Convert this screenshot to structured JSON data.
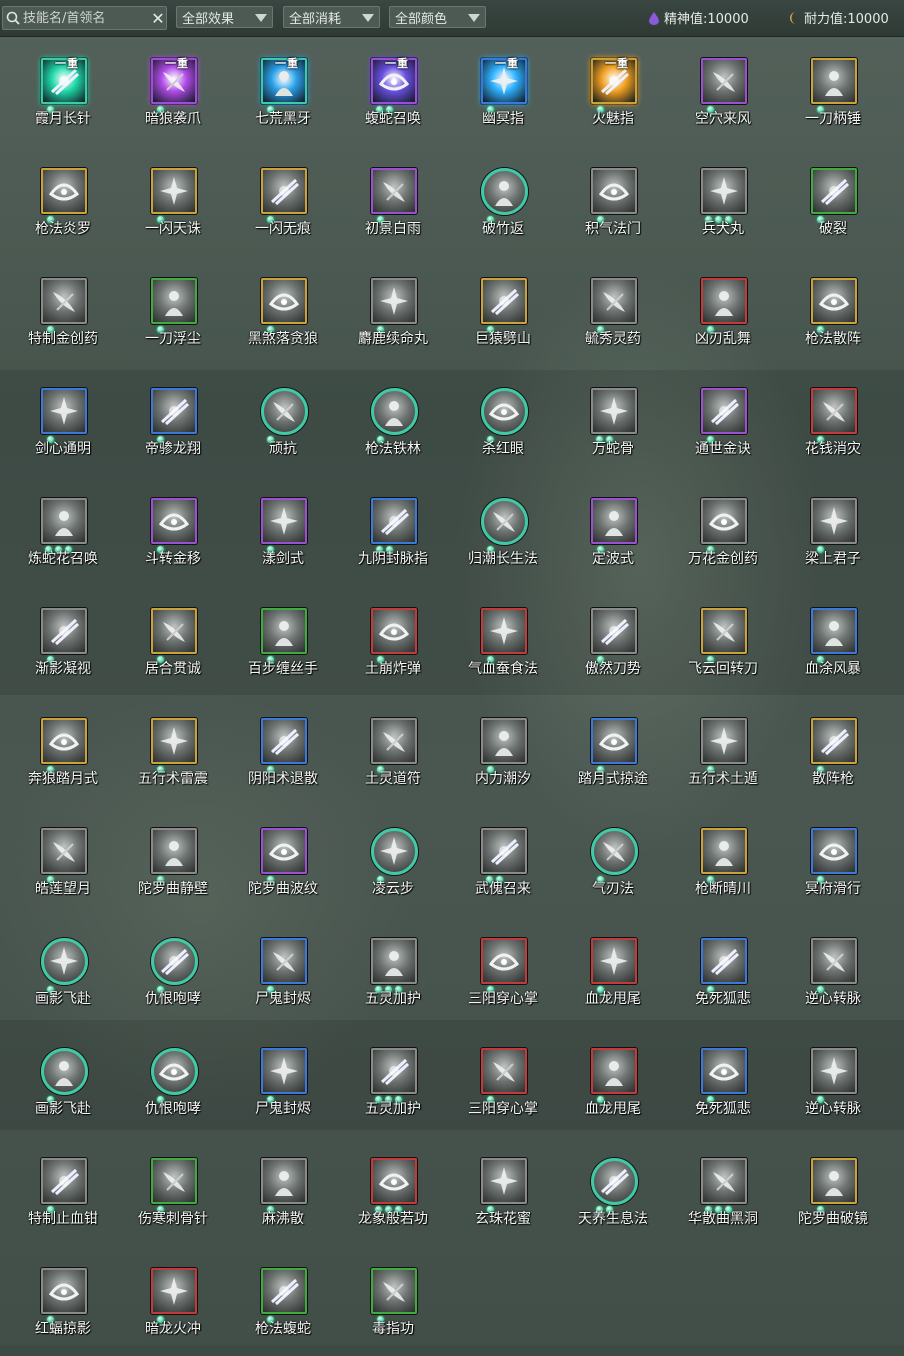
{
  "toolbar": {
    "search_placeholder": "技能名/首领名",
    "filter_effect": "全部效果",
    "filter_cost": "全部消耗",
    "filter_color": "全部颜色",
    "spirit_label": "精神值:10000",
    "stamina_label": "耐力值:10000"
  },
  "colors": {
    "gold": "#c9a23a",
    "purple": "#9b4fd1",
    "blue": "#3b78d8",
    "green": "#3faa3f",
    "teal": "#3fc9a4",
    "red": "#c23a3a",
    "gray": "#8a8a8a"
  },
  "skills": [
    {
      "name": "霞月长针",
      "border": "teal",
      "tag": "一重",
      "dots": 1,
      "glow": "#1fd8a8"
    },
    {
      "name": "暗狼袭爪",
      "border": "purple",
      "tag": "一重",
      "dots": 1,
      "glow": "#b04be8"
    },
    {
      "name": "七荒黑牙",
      "border": "teal",
      "tag": "一重",
      "dots": 1,
      "glow": "#2aa0e8"
    },
    {
      "name": "蝮蛇召唤",
      "border": "purple",
      "tag": "一重",
      "dots": 2,
      "glow": "#6a4fe0"
    },
    {
      "name": "幽冥指",
      "border": "blue",
      "tag": "一重",
      "dots": 1,
      "glow": "#2fb0ff"
    },
    {
      "name": "火魅指",
      "border": "gold",
      "tag": "一重",
      "dots": 1,
      "glow": "#f0a020"
    },
    {
      "name": "空穴来风",
      "border": "purple",
      "tag": "",
      "dots": 1
    },
    {
      "name": "一刀柄锤",
      "border": "gold",
      "tag": "",
      "dots": 1
    },
    {
      "name": "枪法炎罗",
      "border": "gold",
      "tag": "",
      "dots": 1
    },
    {
      "name": "一闪天诛",
      "border": "gold",
      "tag": "",
      "dots": 1
    },
    {
      "name": "一闪无痕",
      "border": "gold",
      "tag": "",
      "dots": 1
    },
    {
      "name": "初景白雨",
      "border": "purple",
      "tag": "",
      "dots": 1
    },
    {
      "name": "破竹返",
      "border": "teal",
      "round": true,
      "tag": "",
      "dots": 1
    },
    {
      "name": "积气法门",
      "border": "gray",
      "tag": "",
      "dots": 1
    },
    {
      "name": "兵犬丸",
      "border": "gray",
      "tag": "",
      "dots": 3
    },
    {
      "name": "破裂",
      "border": "green",
      "tag": "",
      "dots": 1
    },
    {
      "name": "特制金创药",
      "border": "gray",
      "tag": "",
      "dots": 1
    },
    {
      "name": "一刀浮尘",
      "border": "green",
      "tag": "",
      "dots": 1
    },
    {
      "name": "黑煞落贪狼",
      "border": "gold",
      "tag": "",
      "dots": 1
    },
    {
      "name": "麝鹿续命丸",
      "border": "gray",
      "tag": "",
      "dots": 1
    },
    {
      "name": "巨猿劈山",
      "border": "gold",
      "tag": "",
      "dots": 1
    },
    {
      "name": "毓秀灵药",
      "border": "gray",
      "tag": "",
      "dots": 1
    },
    {
      "name": "凶刃乱舞",
      "border": "red",
      "tag": "",
      "dots": 1
    },
    {
      "name": "枪法散阵",
      "border": "gold",
      "tag": "",
      "dots": 1
    },
    {
      "name": "剑心通明",
      "border": "blue",
      "tag": "",
      "dots": 1
    },
    {
      "name": "帝骖龙翔",
      "border": "blue",
      "tag": "",
      "dots": 1
    },
    {
      "name": "顽抗",
      "border": "teal",
      "round": true,
      "tag": "",
      "dots": 1
    },
    {
      "name": "枪法铁林",
      "border": "teal",
      "round": true,
      "tag": "",
      "dots": 1
    },
    {
      "name": "杀红眼",
      "border": "teal",
      "round": true,
      "tag": "",
      "dots": 1
    },
    {
      "name": "万蛇骨",
      "border": "gray",
      "tag": "",
      "dots": 2
    },
    {
      "name": "通世金诀",
      "border": "purple",
      "tag": "",
      "dots": 1
    },
    {
      "name": "花钱消灾",
      "border": "red",
      "tag": "",
      "dots": 1
    },
    {
      "name": "炼蛇花召唤",
      "border": "gray",
      "tag": "",
      "dots": 3
    },
    {
      "name": "斗转金移",
      "border": "purple",
      "tag": "",
      "dots": 1
    },
    {
      "name": "漾剑式",
      "border": "purple",
      "tag": "",
      "dots": 1
    },
    {
      "name": "九阴封脉指",
      "border": "blue",
      "tag": "",
      "dots": 2
    },
    {
      "name": "归潮长生法",
      "border": "teal",
      "round": true,
      "tag": "",
      "dots": 1
    },
    {
      "name": "定波式",
      "border": "purple",
      "tag": "",
      "dots": 1
    },
    {
      "name": "万花金创药",
      "border": "gray",
      "tag": "",
      "dots": 1
    },
    {
      "name": "梁上君子",
      "border": "gray",
      "tag": "",
      "dots": 1
    },
    {
      "name": "渐影凝视",
      "border": "gray",
      "tag": "",
      "dots": 1
    },
    {
      "name": "居合贯诚",
      "border": "gold",
      "tag": "",
      "dots": 1
    },
    {
      "name": "百步缠丝手",
      "border": "green",
      "tag": "",
      "dots": 1
    },
    {
      "name": "土崩炸弹",
      "border": "red",
      "tag": "",
      "dots": 1
    },
    {
      "name": "气血蚕食法",
      "border": "red",
      "tag": "",
      "dots": 1
    },
    {
      "name": "傲然刀势",
      "border": "gray",
      "tag": "",
      "dots": 1
    },
    {
      "name": "飞云回转刀",
      "border": "gold",
      "tag": "",
      "dots": 1
    },
    {
      "name": "血涂风暴",
      "border": "blue",
      "tag": "",
      "dots": 1
    },
    {
      "name": "奔狼踏月式",
      "border": "gold",
      "tag": "",
      "dots": 1
    },
    {
      "name": "五行术雷震",
      "border": "gold",
      "tag": "",
      "dots": 1
    },
    {
      "name": "阴阳术退散",
      "border": "blue",
      "tag": "",
      "dots": 1
    },
    {
      "name": "土灵道符",
      "border": "gray",
      "tag": "",
      "dots": 1
    },
    {
      "name": "内力潮汐",
      "border": "gray",
      "tag": "",
      "dots": 1
    },
    {
      "name": "踏月式掠途",
      "border": "blue",
      "tag": "",
      "dots": 1
    },
    {
      "name": "五行术土遁",
      "border": "gray",
      "tag": "",
      "dots": 1
    },
    {
      "name": "散阵枪",
      "border": "gold",
      "tag": "",
      "dots": 1
    },
    {
      "name": "皓莲望月",
      "border": "gray",
      "tag": "",
      "dots": 1
    },
    {
      "name": "陀罗曲静壁",
      "border": "gray",
      "tag": "",
      "dots": 1
    },
    {
      "name": "陀罗曲波纹",
      "border": "purple",
      "tag": "",
      "dots": 1
    },
    {
      "name": "凌云步",
      "border": "teal",
      "round": true,
      "tag": "",
      "dots": 1
    },
    {
      "name": "武傀召来",
      "border": "gray",
      "tag": "",
      "dots": 2
    },
    {
      "name": "气刃法",
      "border": "teal",
      "round": true,
      "tag": "",
      "dots": 1
    },
    {
      "name": "枪断晴川",
      "border": "gold",
      "tag": "",
      "dots": 1
    },
    {
      "name": "冥府滑行",
      "border": "blue",
      "tag": "",
      "dots": 1
    },
    {
      "name": "画影飞赴",
      "border": "teal",
      "round": true,
      "tag": "",
      "dots": 1
    },
    {
      "name": "仇恨咆哮",
      "border": "teal",
      "round": true,
      "tag": "",
      "dots": 1
    },
    {
      "name": "尸鬼封烬",
      "border": "blue",
      "tag": "",
      "dots": 1
    },
    {
      "name": "五灵加护",
      "border": "gray",
      "tag": "",
      "dots": 3
    },
    {
      "name": "三阳穿心掌",
      "border": "red",
      "tag": "",
      "dots": 1
    },
    {
      "name": "血龙甩尾",
      "border": "red",
      "tag": "",
      "dots": 1
    },
    {
      "name": "免死狐悲",
      "border": "blue",
      "tag": "",
      "dots": 1
    },
    {
      "name": "逆心转脉",
      "border": "gray",
      "tag": "",
      "dots": 1
    },
    {
      "name": "画影飞赴",
      "border": "teal",
      "round": true,
      "tag": "",
      "dots": 1
    },
    {
      "name": "仇恨咆哮",
      "border": "teal",
      "round": true,
      "tag": "",
      "dots": 1
    },
    {
      "name": "尸鬼封烬",
      "border": "blue",
      "tag": "",
      "dots": 1
    },
    {
      "name": "五灵加护",
      "border": "gray",
      "tag": "",
      "dots": 3
    },
    {
      "name": "三阳穿心掌",
      "border": "red",
      "tag": "",
      "dots": 1
    },
    {
      "name": "血龙甩尾",
      "border": "red",
      "tag": "",
      "dots": 1
    },
    {
      "name": "免死狐悲",
      "border": "blue",
      "tag": "",
      "dots": 1
    },
    {
      "name": "逆心转脉",
      "border": "gray",
      "tag": "",
      "dots": 1
    },
    {
      "name": "特制止血钳",
      "border": "gray",
      "tag": "",
      "dots": 1
    },
    {
      "name": "伤寒刺骨针",
      "border": "green",
      "tag": "",
      "dots": 1
    },
    {
      "name": "麻沸散",
      "border": "gray",
      "tag": "",
      "dots": 1
    },
    {
      "name": "龙象般若功",
      "border": "red",
      "tag": "",
      "dots": 3
    },
    {
      "name": "玄珠花蜜",
      "border": "gray",
      "tag": "",
      "dots": 1
    },
    {
      "name": "天养生息法",
      "border": "teal",
      "round": true,
      "tag": "",
      "dots": 2
    },
    {
      "name": "华散曲黑洞",
      "border": "gray",
      "tag": "",
      "dots": 3
    },
    {
      "name": "陀罗曲破镜",
      "border": "gold",
      "tag": "",
      "dots": 1
    },
    {
      "name": "红蝠掠影",
      "border": "gray",
      "tag": "",
      "dots": 1
    },
    {
      "name": "暗龙火冲",
      "border": "red",
      "tag": "",
      "dots": 1
    },
    {
      "name": "枪法蝮蛇",
      "border": "green",
      "tag": "",
      "dots": 1
    },
    {
      "name": "毒指功",
      "border": "green",
      "tag": "",
      "dots": 1
    }
  ]
}
